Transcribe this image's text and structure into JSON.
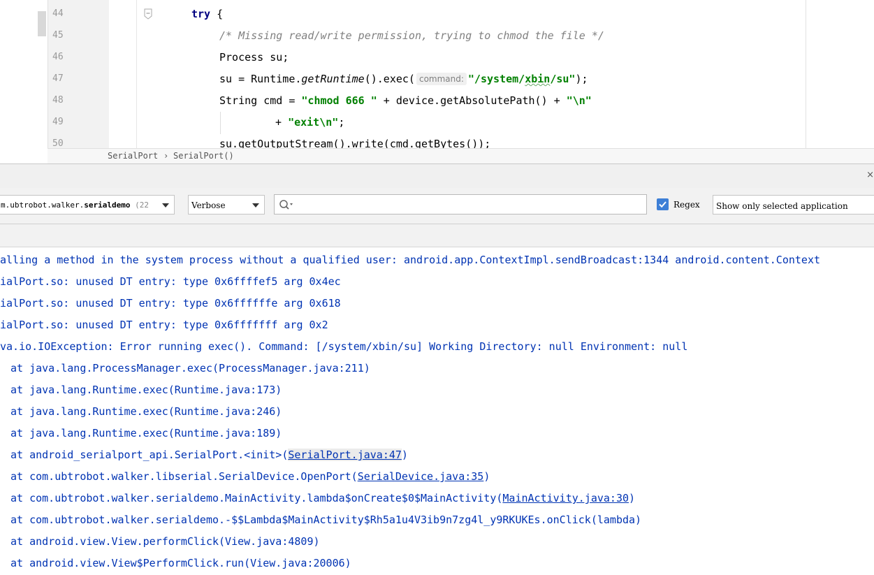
{
  "editor": {
    "line_numbers": [
      "44",
      "45",
      "46",
      "47",
      "48",
      "49",
      "50"
    ],
    "code": {
      "l44_kw": "try",
      "l44_rest": " {",
      "l45_comment": "/* Missing read/write permission, trying to chmod the file */",
      "l46": "Process su;",
      "l47_a": "su = Runtime.",
      "l47_method": "getRuntime",
      "l47_b": "().exec(",
      "l47_hint": "command:",
      "l47_str1": "\"/system/",
      "l47_str2": "xbin",
      "l47_str3": "/su\"",
      "l47_end": ");",
      "l48_a": "String cmd = ",
      "l48_str1": "\"chmod 666 \"",
      "l48_b": " + device.getAbsolutePath() + ",
      "l48_str2": "\"\\n\"",
      "l49_a": "+ ",
      "l49_str": "\"exit\\n\"",
      "l49_end": ";",
      "l50": "su.getOutputStream().write(cmd.getBytes());"
    },
    "breadcrumb": {
      "class_name": "SerialPort",
      "separator": "›",
      "method_name": "SerialPort()"
    }
  },
  "logcat": {
    "close_label": "×",
    "process": {
      "prefix": "m.ubtrobot.walker.",
      "bold": "serialdemo",
      "pid": " (22"
    },
    "level": "Verbose",
    "search": {
      "value": "",
      "placeholder": ""
    },
    "regex": {
      "label": "Regex",
      "checked": true,
      "check_glyph": "✔"
    },
    "filter": "Show only selected application",
    "lines": [
      {
        "text": "alling a method in the system process without a qualified user: android.app.ContextImpl.sendBroadcast:1344 android.content.Context"
      },
      {
        "text": "ialPort.so: unused DT entry: type 0x6ffffef5 arg 0x4ec"
      },
      {
        "text": "ialPort.so: unused DT entry: type 0x6ffffffe arg 0x618"
      },
      {
        "text": "ialPort.so: unused DT entry: type 0x6fffffff arg 0x2"
      },
      {
        "text": "va.io.IOException: Error running exec(). Command: [/system/xbin/su] Working Directory: null Environment: null"
      },
      {
        "text": "at java.lang.ProcessManager.exec(ProcessManager.java:211)"
      },
      {
        "text": "at java.lang.Runtime.exec(Runtime.java:173)"
      },
      {
        "text": "at java.lang.Runtime.exec(Runtime.java:246)"
      },
      {
        "text": "at java.lang.Runtime.exec(Runtime.java:189)"
      },
      {
        "pre": "at android_serialport_api.SerialPort.<init>(",
        "link": "SerialPort.java:47",
        "post": ")"
      },
      {
        "pre": "at com.ubtrobot.walker.libserial.SerialDevice.OpenPort(",
        "link": "SerialDevice.java:35",
        "post": ")"
      },
      {
        "pre": "at com.ubtrobot.walker.serialdemo.MainActivity.lambda$onCreate$0$MainActivity(",
        "link": "MainActivity.java:30",
        "post": ")"
      },
      {
        "text": "at com.ubtrobot.walker.serialdemo.-$$Lambda$MainActivity$Rh5a1u4V3ib9n7zg4l_y9RKUKEs.onClick(lambda)"
      },
      {
        "text": "at android.view.View.performClick(View.java:4809)"
      },
      {
        "text": "at android.view.View$PerformClick.run(View.java:20006)"
      }
    ]
  }
}
